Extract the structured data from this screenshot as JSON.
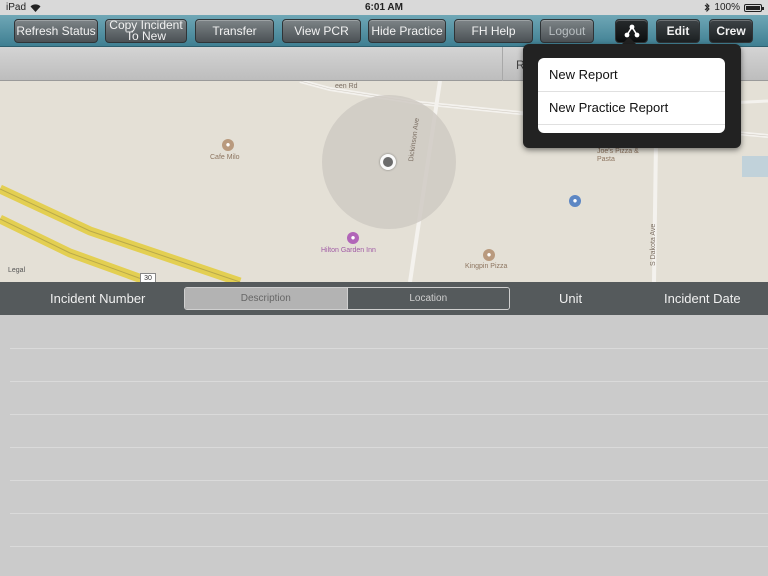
{
  "status_bar": {
    "device": "iPad",
    "time": "6:01 AM",
    "battery": "100%",
    "battery_level": 1.0
  },
  "toolbar": {
    "refresh_status": "Refresh Status",
    "copy_incident": "Copy Incident To New",
    "transfer": "Transfer",
    "view_pcr": "View PCR",
    "hide_practice": "Hide Practice",
    "fh_help": "FH Help",
    "logout": "Logout",
    "edit": "Edit",
    "crew": "Crew",
    "share_icon": "share-icon"
  },
  "subheader": {
    "partial_text": "R"
  },
  "map": {
    "labels": {
      "cafe": "Cafe Milo",
      "joes": "Joe's Pizza & Pasta",
      "dickinson": "Dickinson Ave",
      "hotel": "Hilton Garden Inn",
      "kingpin": "Kingpin Pizza",
      "dakota": "S Dakota Ave",
      "street": "een Rd",
      "legal": "Legal",
      "shield": "30"
    },
    "colors": {
      "road_yellow": "#e3cf52",
      "water": "#c1d2da",
      "accuracy": "#cfcac3"
    }
  },
  "columns": {
    "incident_number": "Incident Number",
    "description": "Description",
    "location": "Location",
    "unit": "Unit",
    "incident_date": "Incident Date",
    "selected_segment": "Description"
  },
  "popover": {
    "items": [
      {
        "label": "New Report"
      },
      {
        "label": "New Practice Report"
      }
    ]
  }
}
